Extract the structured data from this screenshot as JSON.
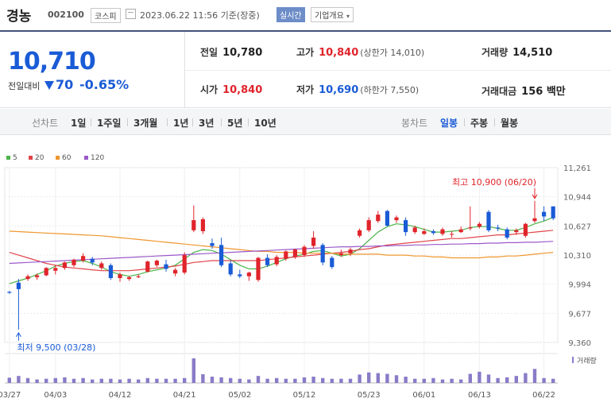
{
  "header": {
    "name": "경농",
    "code": "002100",
    "market": "코스피",
    "timestamp": "2023.06.22 11:56 기준(장중)",
    "realtime_label": "실시간",
    "company_label": "기업개요"
  },
  "price": {
    "current": "10,710",
    "change_label": "전일대비",
    "change": "70",
    "change_pct": "-0.65%"
  },
  "stats": {
    "prev_label": "전일",
    "prev": "10,780",
    "high_label": "고가",
    "high": "10,840",
    "upper_limit": "(상한가 14,010)",
    "volume_label": "거래량",
    "volume": "14,510",
    "open_label": "시가",
    "open": "10,840",
    "low_label": "저가",
    "low": "10,690",
    "lower_limit": "(하한가 7,550)",
    "value_label": "거래대금",
    "value": "156 백만"
  },
  "tabs": {
    "line_label": "선차트",
    "line_periods": [
      "1일",
      "1주일",
      "3개월",
      "1년",
      "3년",
      "5년",
      "10년"
    ],
    "candle_label": "봉차트",
    "candle_periods": [
      "일봉",
      "주봉",
      "월봉"
    ],
    "active_candle": "일봉"
  },
  "chart_data": {
    "type": "candlestick",
    "legend": [
      {
        "name": "5",
        "color": "#4bb54a"
      },
      {
        "name": "20",
        "color": "#e0454a"
      },
      {
        "name": "60",
        "color": "#f0962e"
      },
      {
        "name": "120",
        "color": "#9b59c9"
      }
    ],
    "y_ticks": [
      "11,261",
      "10,944",
      "10,627",
      "10,310",
      "9,994",
      "9,677",
      "9,360"
    ],
    "ylim": [
      9360,
      11261
    ],
    "x_ticks": [
      {
        "label": "03/27",
        "i": 0
      },
      {
        "label": "04/03",
        "i": 5
      },
      {
        "label": "04/12",
        "i": 12
      },
      {
        "label": "04/21",
        "i": 19
      },
      {
        "label": "05/02",
        "i": 25
      },
      {
        "label": "05/12",
        "i": 32
      },
      {
        "label": "05/23",
        "i": 39
      },
      {
        "label": "06/01",
        "i": 45
      },
      {
        "label": "06/13",
        "i": 51
      },
      {
        "label": "06/22",
        "i": 58
      }
    ],
    "volume_label": "거래량",
    "max_annotation": {
      "text": "최고 10,900 (06/20)",
      "i": 57,
      "value": 10900
    },
    "min_annotation": {
      "text": "최저 9,500 (03/28)",
      "i": 1,
      "value": 9500
    },
    "up_color": "#e0242b",
    "down_color": "#1a5bd6",
    "candles": [
      {
        "o": 9910,
        "h": 9920,
        "l": 9890,
        "c": 9900,
        "v": 15
      },
      {
        "o": 10010,
        "h": 10050,
        "l": 9500,
        "c": 9940,
        "v": 20
      },
      {
        "o": 10050,
        "h": 10100,
        "l": 10030,
        "c": 10080,
        "v": 14
      },
      {
        "o": 10070,
        "h": 10110,
        "l": 10040,
        "c": 10090,
        "v": 10
      },
      {
        "o": 10090,
        "h": 10180,
        "l": 10080,
        "c": 10170,
        "v": 12
      },
      {
        "o": 10140,
        "h": 10200,
        "l": 10100,
        "c": 10170,
        "v": 14
      },
      {
        "o": 10170,
        "h": 10240,
        "l": 10150,
        "c": 10230,
        "v": 16
      },
      {
        "o": 10200,
        "h": 10270,
        "l": 10180,
        "c": 10260,
        "v": 12
      },
      {
        "o": 10250,
        "h": 10330,
        "l": 10230,
        "c": 10300,
        "v": 14
      },
      {
        "o": 10270,
        "h": 10290,
        "l": 10200,
        "c": 10230,
        "v": 10
      },
      {
        "o": 10170,
        "h": 10240,
        "l": 10150,
        "c": 10220,
        "v": 12
      },
      {
        "o": 10200,
        "h": 10220,
        "l": 10040,
        "c": 10060,
        "v": 12
      },
      {
        "o": 10060,
        "h": 10120,
        "l": 10020,
        "c": 10100,
        "v": 10
      },
      {
        "o": 10050,
        "h": 10080,
        "l": 10030,
        "c": 10070,
        "v": 12
      },
      {
        "o": 10070,
        "h": 10100,
        "l": 10060,
        "c": 10080,
        "v": 10
      },
      {
        "o": 10130,
        "h": 10250,
        "l": 10120,
        "c": 10240,
        "v": 14
      },
      {
        "o": 10200,
        "h": 10260,
        "l": 10180,
        "c": 10250,
        "v": 12
      },
      {
        "o": 10210,
        "h": 10260,
        "l": 10130,
        "c": 10160,
        "v": 12
      },
      {
        "o": 10110,
        "h": 10170,
        "l": 10080,
        "c": 10150,
        "v": 12
      },
      {
        "o": 10120,
        "h": 10340,
        "l": 10100,
        "c": 10310,
        "v": 14
      },
      {
        "o": 10580,
        "h": 10850,
        "l": 10560,
        "c": 10690,
        "v": 70
      },
      {
        "o": 10570,
        "h": 10720,
        "l": 10540,
        "c": 10700,
        "v": 25
      },
      {
        "o": 10440,
        "h": 10490,
        "l": 10380,
        "c": 10410,
        "v": 18
      },
      {
        "o": 10420,
        "h": 10500,
        "l": 10180,
        "c": 10200,
        "v": 16
      },
      {
        "o": 10220,
        "h": 10250,
        "l": 10080,
        "c": 10100,
        "v": 14
      },
      {
        "o": 10100,
        "h": 10150,
        "l": 10060,
        "c": 10080,
        "v": 12
      },
      {
        "o": 10080,
        "h": 10130,
        "l": 10030,
        "c": 10120,
        "v": 10
      },
      {
        "o": 10040,
        "h": 10290,
        "l": 10020,
        "c": 10280,
        "v": 20
      },
      {
        "o": 10280,
        "h": 10320,
        "l": 10180,
        "c": 10200,
        "v": 12
      },
      {
        "o": 10210,
        "h": 10310,
        "l": 10190,
        "c": 10290,
        "v": 14
      },
      {
        "o": 10270,
        "h": 10360,
        "l": 10250,
        "c": 10350,
        "v": 12
      },
      {
        "o": 10290,
        "h": 10380,
        "l": 10270,
        "c": 10370,
        "v": 12
      },
      {
        "o": 10310,
        "h": 10420,
        "l": 10290,
        "c": 10400,
        "v": 16
      },
      {
        "o": 10410,
        "h": 10570,
        "l": 10380,
        "c": 10500,
        "v": 18
      },
      {
        "o": 10420,
        "h": 10440,
        "l": 10200,
        "c": 10230,
        "v": 14
      },
      {
        "o": 10280,
        "h": 10300,
        "l": 10160,
        "c": 10180,
        "v": 12
      },
      {
        "o": 10310,
        "h": 10370,
        "l": 10290,
        "c": 10330,
        "v": 12
      },
      {
        "o": 10330,
        "h": 10390,
        "l": 10300,
        "c": 10370,
        "v": 12
      },
      {
        "o": 10520,
        "h": 10600,
        "l": 10500,
        "c": 10580,
        "v": 24
      },
      {
        "o": 10580,
        "h": 10720,
        "l": 10560,
        "c": 10690,
        "v": 30
      },
      {
        "o": 10680,
        "h": 10790,
        "l": 10660,
        "c": 10750,
        "v": 28
      },
      {
        "o": 10790,
        "h": 10800,
        "l": 10620,
        "c": 10630,
        "v": 26
      },
      {
        "o": 10690,
        "h": 10740,
        "l": 10660,
        "c": 10720,
        "v": 22
      },
      {
        "o": 10690,
        "h": 10720,
        "l": 10520,
        "c": 10560,
        "v": 18
      },
      {
        "o": 10560,
        "h": 10630,
        "l": 10540,
        "c": 10610,
        "v": 12
      },
      {
        "o": 10540,
        "h": 10600,
        "l": 10530,
        "c": 10570,
        "v": 12
      },
      {
        "o": 10570,
        "h": 10590,
        "l": 10530,
        "c": 10550,
        "v": 14
      },
      {
        "o": 10540,
        "h": 10610,
        "l": 10520,
        "c": 10590,
        "v": 10
      },
      {
        "o": 10540,
        "h": 10570,
        "l": 10500,
        "c": 10540,
        "v": 12
      },
      {
        "o": 10560,
        "h": 10620,
        "l": 10550,
        "c": 10590,
        "v": 10
      },
      {
        "o": 10600,
        "h": 10840,
        "l": 10580,
        "c": 10610,
        "v": 26
      },
      {
        "o": 10620,
        "h": 10670,
        "l": 10600,
        "c": 10650,
        "v": 32
      },
      {
        "o": 10780,
        "h": 10800,
        "l": 10560,
        "c": 10580,
        "v": 24
      },
      {
        "o": 10610,
        "h": 10640,
        "l": 10570,
        "c": 10600,
        "v": 14
      },
      {
        "o": 10590,
        "h": 10610,
        "l": 10480,
        "c": 10500,
        "v": 16
      },
      {
        "o": 10560,
        "h": 10600,
        "l": 10530,
        "c": 10580,
        "v": 20
      },
      {
        "o": 10520,
        "h": 10660,
        "l": 10500,
        "c": 10650,
        "v": 28
      },
      {
        "o": 10680,
        "h": 10900,
        "l": 10660,
        "c": 10710,
        "v": 40
      },
      {
        "o": 10780,
        "h": 10840,
        "l": 10680,
        "c": 10730,
        "v": 14
      },
      {
        "o": 10840,
        "h": 10840,
        "l": 10690,
        "c": 10710,
        "v": 12
      }
    ],
    "ma_lines": [
      {
        "name": "5",
        "color": "#4bb54a",
        "values": [
          10000,
          10030,
          10060,
          10100,
          10140,
          10190,
          10220,
          10240,
          10250,
          10220,
          10180,
          10130,
          10100,
          10080,
          10100,
          10130,
          10150,
          10170,
          10200,
          10270,
          10340,
          10370,
          10360,
          10320,
          10260,
          10200,
          10160,
          10160,
          10190,
          10230,
          10270,
          10300,
          10320,
          10350,
          10360,
          10330,
          10300,
          10320,
          10380,
          10470,
          10560,
          10620,
          10650,
          10640,
          10620,
          10590,
          10560,
          10560,
          10570,
          10580,
          10610,
          10620,
          10620,
          10600,
          10580,
          10580,
          10610,
          10650,
          10680,
          10720
        ]
      },
      {
        "name": "20",
        "color": "#e0454a",
        "values": [
          10340,
          10310,
          10280,
          10250,
          10220,
          10200,
          10180,
          10170,
          10160,
          10150,
          10140,
          10140,
          10140,
          10140,
          10150,
          10160,
          10170,
          10180,
          10190,
          10210,
          10230,
          10240,
          10250,
          10250,
          10250,
          10250,
          10250,
          10250,
          10260,
          10270,
          10280,
          10290,
          10300,
          10310,
          10320,
          10330,
          10340,
          10350,
          10370,
          10380,
          10400,
          10420,
          10430,
          10440,
          10450,
          10460,
          10470,
          10480,
          10490,
          10490,
          10500,
          10510,
          10520,
          10530,
          10530,
          10540,
          10550,
          10560,
          10570,
          10580
        ]
      },
      {
        "name": "60",
        "color": "#f0962e",
        "values": [
          10570,
          10565,
          10560,
          10555,
          10550,
          10545,
          10540,
          10535,
          10530,
          10525,
          10520,
          10510,
          10500,
          10490,
          10480,
          10470,
          10460,
          10450,
          10440,
          10430,
          10420,
          10410,
          10400,
          10390,
          10380,
          10370,
          10360,
          10350,
          10350,
          10340,
          10340,
          10340,
          10330,
          10330,
          10330,
          10330,
          10320,
          10320,
          10320,
          10320,
          10320,
          10310,
          10310,
          10310,
          10300,
          10300,
          10290,
          10290,
          10280,
          10280,
          10280,
          10280,
          10290,
          10290,
          10300,
          10300,
          10310,
          10320,
          10330,
          10340
        ]
      },
      {
        "name": "120",
        "color": "#9b59c9",
        "values": [
          10220,
          10225,
          10230,
          10235,
          10240,
          10245,
          10250,
          10255,
          10260,
          10265,
          10270,
          10275,
          10280,
          10285,
          10290,
          10295,
          10300,
          10305,
          10310,
          10315,
          10320,
          10325,
          10330,
          10335,
          10340,
          10345,
          10350,
          10355,
          10360,
          10365,
          10370,
          10375,
          10380,
          10385,
          10390,
          10395,
          10400,
          10400,
          10405,
          10405,
          10410,
          10410,
          10415,
          10415,
          10420,
          10420,
          10425,
          10425,
          10430,
          10430,
          10435,
          10435,
          10440,
          10440,
          10445,
          10445,
          10450,
          10450,
          10455,
          10460
        ]
      }
    ]
  }
}
